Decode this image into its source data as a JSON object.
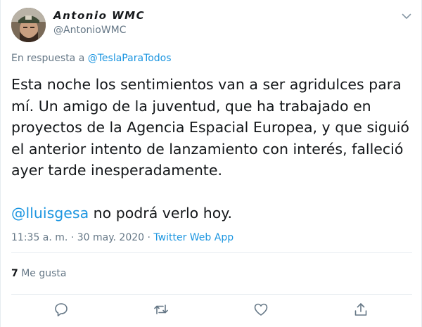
{
  "author": {
    "display_name": "𝘼𝙣𝙩𝙤𝙣𝙞𝙤 𝙒𝙈𝘾",
    "handle": "@AntonioWMC"
  },
  "reply": {
    "prefix": "En respuesta a",
    "mention": "@TeslaParaTodos"
  },
  "tweet": {
    "lines": [
      "Esta noche los sentimientos van a ser agridulces para",
      "mí. Un amigo de la juventud, que ha trabajado en",
      "proyectos de la Agencia Espacial Europea, y que siguió",
      "el anterior intento de lanzamiento con interés, falleció",
      "ayer tarde inesperadamente."
    ],
    "mention": "@lluisgesa",
    "mention_rest": " no podrá verlo hoy."
  },
  "meta": {
    "time": "11:35 a. m.",
    "separator": " · ",
    "date": "30 may. 2020",
    "separator2": " · ",
    "source": "Twitter Web App"
  },
  "likes": {
    "count": "7",
    "label": " Me gusta"
  },
  "icons": {
    "caret": "chevron-down-icon",
    "reply": "reply-icon",
    "retweet": "retweet-icon",
    "like": "heart-icon",
    "share": "share-icon"
  },
  "colors": {
    "text": "#14171a",
    "secondary": "#657786",
    "link": "#1b95e0",
    "divider": "#e6ecf0"
  }
}
